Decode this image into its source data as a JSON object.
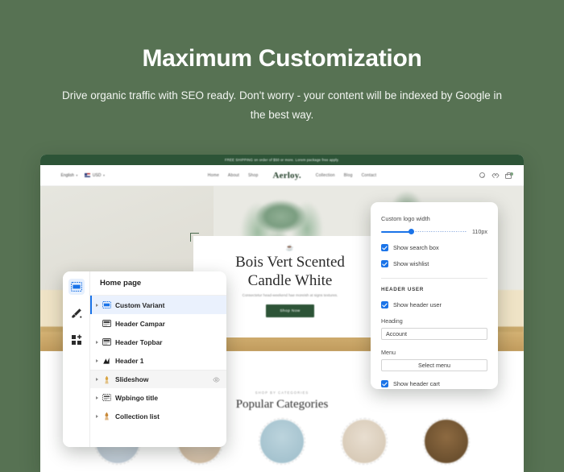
{
  "hero": {
    "title": "Maximum Customization",
    "subtitle": "Drive organic traffic with SEO ready.  Don't worry - your content will be indexed by Google in the best way."
  },
  "storefront": {
    "announcement": "FREE SHIPPING on order of $50 or more. Lorem package free apply.",
    "topbar": {
      "language": "English",
      "currency": "USD",
      "brand": "Aerloy.",
      "nav_left": [
        "Home",
        "About",
        "Shop"
      ],
      "nav_right": [
        "Collection",
        "Blog",
        "Contact"
      ],
      "icons": [
        "search-icon",
        "wishlist-icon",
        "cart-icon"
      ],
      "cart_count": ""
    },
    "hero_slide": {
      "eyebrow_glyph": "logo-mark",
      "title_line1": "Bois Vert Scented",
      "title_line2": "Candle White",
      "description": "Consectetur head-weekend hae moreish at signs textures.",
      "cta": "Shop Now"
    },
    "categories": {
      "eyebrow": "SHOP BY CATEGORIES",
      "title": "Popular Categories",
      "items": [
        "category-1",
        "category-2",
        "category-3",
        "category-4",
        "category-5"
      ]
    }
  },
  "sections_panel": {
    "rail": [
      {
        "name": "sections-tab",
        "icon": "layout-icon",
        "active": true
      },
      {
        "name": "theme-settings-tab",
        "icon": "paintbrush-icon",
        "active": false
      },
      {
        "name": "apps-tab",
        "icon": "apps-grid-icon",
        "active": false
      }
    ],
    "title": "Home page",
    "items": [
      {
        "label": "Custom Variant",
        "icon": "layout-icon",
        "state": "selected",
        "expandable": true,
        "eye": false
      },
      {
        "label": "Header Campar",
        "icon": "header-icon",
        "state": "normal",
        "expandable": false,
        "eye": false
      },
      {
        "label": "Header Topbar",
        "icon": "header-icon",
        "state": "normal",
        "expandable": true,
        "eye": false
      },
      {
        "label": "Header 1",
        "icon": "chart-icon",
        "state": "normal",
        "expandable": true,
        "eye": false
      },
      {
        "label": "Slideshow",
        "icon": "image-icon",
        "state": "hovered",
        "expandable": true,
        "eye": true
      },
      {
        "label": "Wpbingo title",
        "icon": "text-block-icon",
        "state": "normal",
        "expandable": true,
        "eye": false
      },
      {
        "label": "Collection list",
        "icon": "collection-icon",
        "state": "normal",
        "expandable": true,
        "eye": false
      }
    ]
  },
  "settings_panel": {
    "logo_width": {
      "label": "Custom logo width",
      "value": "110px",
      "fill_percent": 35
    },
    "toggles_top": [
      {
        "label": "Show search box",
        "checked": true
      },
      {
        "label": "Show wishlist",
        "checked": true
      }
    ],
    "header_user": {
      "section_title": "HEADER USER",
      "show_toggle": {
        "label": "Show header user",
        "checked": true
      },
      "heading_label": "Heading",
      "heading_value": "Account",
      "menu_label": "Menu",
      "menu_button": "Select menu",
      "cart_toggle": {
        "label": "Show header cart",
        "checked": true
      }
    }
  },
  "colors": {
    "background": "#577253",
    "brand_green": "#2d5437",
    "accent_blue": "#1a73e8",
    "selected_row": "#eaf1fd"
  }
}
